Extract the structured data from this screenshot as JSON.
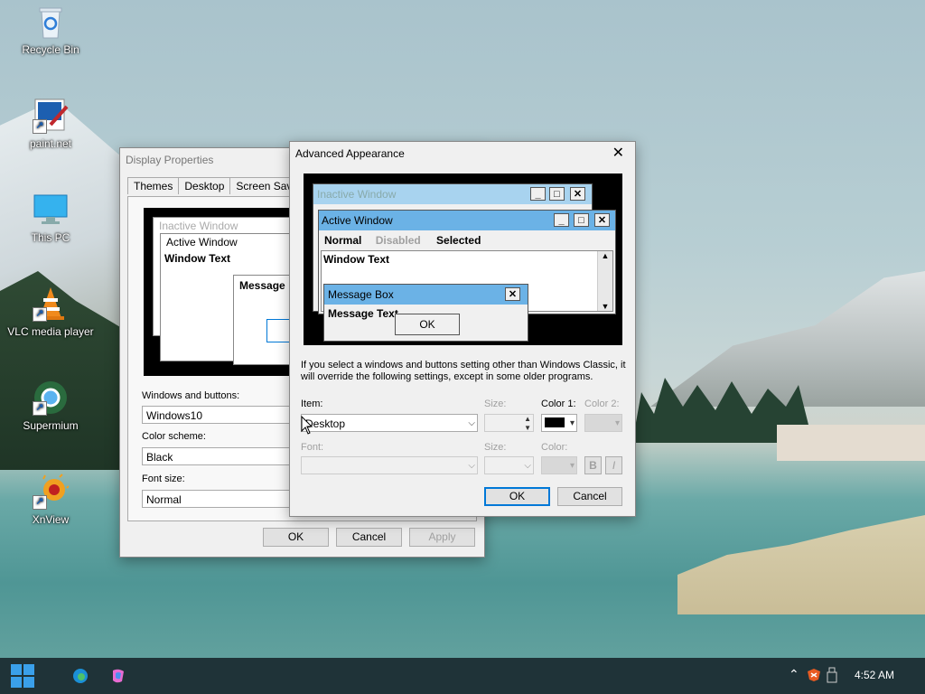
{
  "desktop": {
    "icons": [
      {
        "label": "Recycle Bin"
      },
      {
        "label": "paint.net"
      },
      {
        "label": "This PC"
      },
      {
        "label": "VLC media player"
      },
      {
        "label": "Supermium"
      },
      {
        "label": "XnView"
      }
    ]
  },
  "display_properties": {
    "title": "Display Properties",
    "tabs": [
      "Themes",
      "Desktop",
      "Screen Saver"
    ],
    "preview": {
      "inactive": "Inactive Window",
      "active": "Active Window",
      "window_text": "Window Text",
      "message": "Message"
    },
    "windows_buttons_label": "Windows and buttons:",
    "windows_buttons_value": "Windows10",
    "color_scheme_label": "Color scheme:",
    "color_scheme_value": "Black",
    "font_size_label": "Font size:",
    "font_size_value": "Normal",
    "ok": "OK",
    "cancel": "Cancel",
    "apply": "Apply"
  },
  "advanced": {
    "title": "Advanced Appearance",
    "preview": {
      "inactive": "Inactive Window",
      "active": "Active Window",
      "menu_normal": "Normal",
      "menu_disabled": "Disabled",
      "menu_selected": "Selected",
      "window_text": "Window Text",
      "msgbox_title": "Message Box",
      "msgbox_text": "Message Text",
      "msgbox_ok": "OK"
    },
    "info": "If you select a windows and buttons setting other than Windows Classic, it will override the following settings, except in some older programs.",
    "item_label": "Item:",
    "item_value": "Desktop",
    "size_label": "Size:",
    "color1_label": "Color 1:",
    "color2_label": "Color 2:",
    "font_label": "Font:",
    "font_size_label": "Size:",
    "font_color_label": "Color:",
    "bold": "B",
    "italic": "I",
    "ok": "OK",
    "cancel": "Cancel",
    "close_glyph": "✕"
  },
  "taskbar": {
    "time": "4:52 AM"
  },
  "colors": {
    "accent": "#0078d7",
    "active_title": "#6bb2e6",
    "inactive_title": "#a8d3ef",
    "taskbar": "#1f3338"
  }
}
